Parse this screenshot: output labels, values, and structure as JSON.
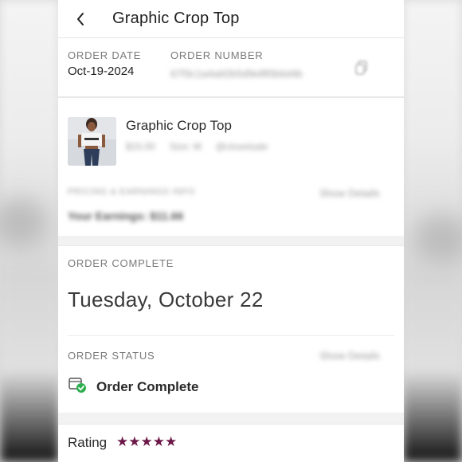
{
  "header": {
    "title": "Graphic Crop Top",
    "back_icon": "chevron-left-icon"
  },
  "order_info": {
    "date_label": "ORDER DATE",
    "date_value": "Oct-19-2024",
    "number_label": "ORDER NUMBER",
    "number_value": "67f3c1a4a92b5d9e8f0b6d4b",
    "copy_icon": "copy-icon"
  },
  "product": {
    "title": "Graphic Crop Top",
    "price": "$15.00",
    "size": "Size: M",
    "seller": "@closetsale",
    "pricing_label": "PRICING & EARNINGS INFO",
    "pricing_link": "Show Details",
    "earnings": "Your Earnings: $11.66"
  },
  "order_complete": {
    "label": "ORDER COMPLETE",
    "date": "Tuesday, October 22"
  },
  "order_status": {
    "label": "ORDER STATUS",
    "link": "Show Details",
    "status": "Order Complete",
    "icon": "package-check-icon"
  },
  "rating": {
    "label": "Rating",
    "stars": "★★★★★",
    "value": 5,
    "max": 5
  },
  "colors": {
    "star": "#6b1747",
    "check": "#2eae4f",
    "text": "#2a2a2a",
    "muted": "#7a7a7a"
  }
}
